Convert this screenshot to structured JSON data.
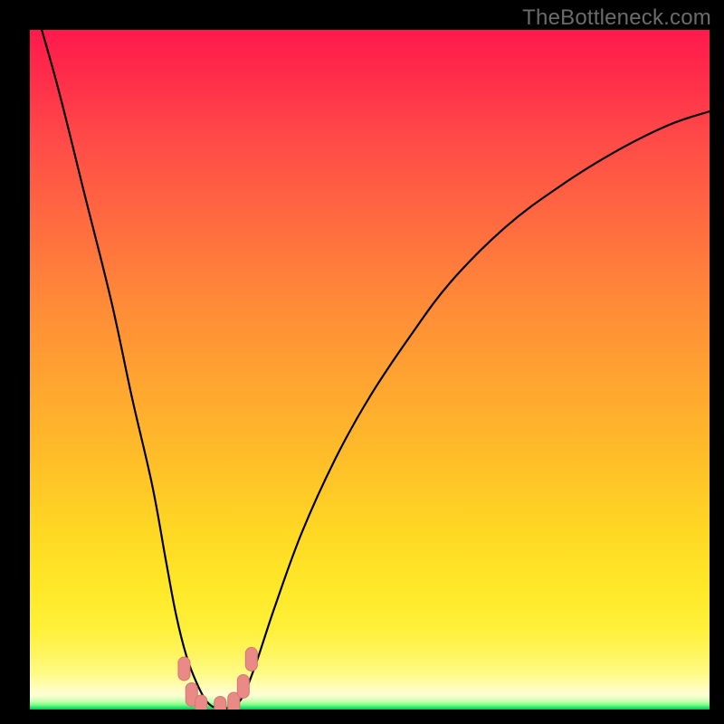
{
  "watermark": "TheBottleneck.com",
  "colors": {
    "frame": "#000000",
    "curve": "#000000",
    "marker_fill": "#e98a87",
    "marker_stroke": "#d47674"
  },
  "chart_data": {
    "type": "line",
    "title": "",
    "xlabel": "",
    "ylabel": "",
    "xlim": [
      0,
      100
    ],
    "ylim": [
      0,
      100
    ],
    "grid": false,
    "legend": false,
    "series": [
      {
        "name": "bottleneck-curve",
        "x": [
          0,
          4,
          8,
          12,
          15,
          18,
          20,
          21.5,
          23,
          24.5,
          26,
          27.5,
          29,
          31,
          33,
          36,
          40,
          45,
          50,
          56,
          62,
          70,
          78,
          86,
          94,
          100
        ],
        "values": [
          106,
          92,
          76,
          60,
          46,
          33,
          22,
          14,
          8,
          4,
          1.2,
          0.2,
          0.2,
          1.4,
          6,
          15,
          26,
          37,
          46,
          55,
          63,
          71,
          77,
          82,
          86,
          88
        ]
      }
    ],
    "markers": [
      {
        "x": 22.7,
        "y": 6.0
      },
      {
        "x": 23.8,
        "y": 2.2
      },
      {
        "x": 25.2,
        "y": 0.4
      },
      {
        "x": 28.0,
        "y": 0.2
      },
      {
        "x": 30.0,
        "y": 0.8
      },
      {
        "x": 31.4,
        "y": 3.4
      },
      {
        "x": 32.6,
        "y": 7.4
      }
    ],
    "background": {
      "type": "vertical-gradient",
      "description": "red-to-yellow-to-green heat gradient",
      "stops": [
        {
          "pos": 0.0,
          "color": "#ff1a4d"
        },
        {
          "pos": 0.4,
          "color": "#ff8a38"
        },
        {
          "pos": 0.82,
          "color": "#ffe828"
        },
        {
          "pos": 0.97,
          "color": "#fffccf"
        },
        {
          "pos": 1.0,
          "color": "#0fb85a"
        }
      ]
    }
  }
}
